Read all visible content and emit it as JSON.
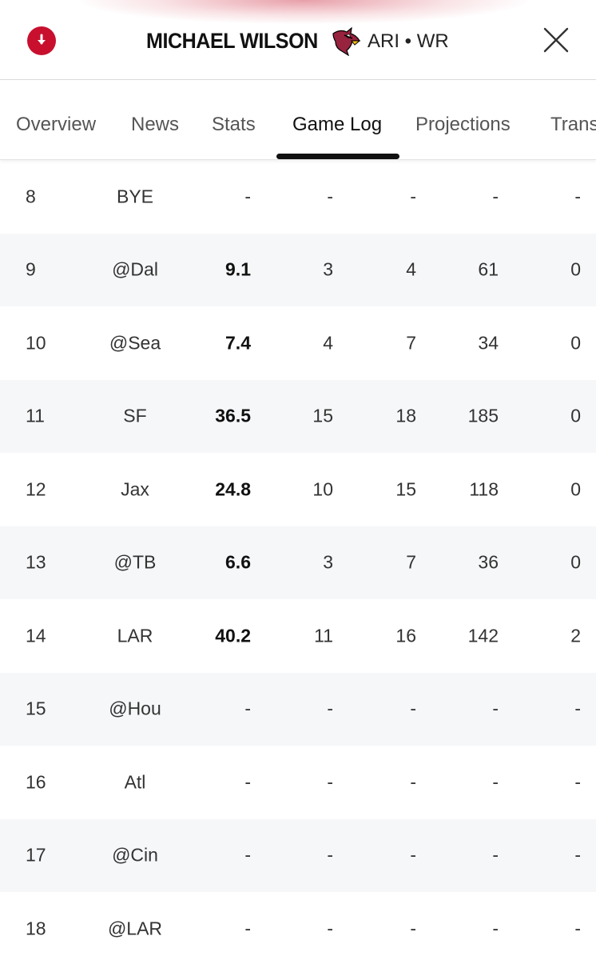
{
  "header": {
    "player_name": "MICHAEL WILSON",
    "team_position": "ARI • WR",
    "accent_color": "#c8102e",
    "icons": [
      "download-icon",
      "cardinals-logo",
      "close-icon"
    ]
  },
  "tabs": [
    {
      "label": "Overview"
    },
    {
      "label": "News"
    },
    {
      "label": "Stats"
    },
    {
      "label": "Game Log",
      "active": true
    },
    {
      "label": "Projections"
    },
    {
      "label": "Trans"
    }
  ],
  "game_log": {
    "rows": [
      {
        "week": "8",
        "opp": "BYE",
        "pts": "-",
        "rec": "-",
        "tgt": "-",
        "yds": "-",
        "td": "-"
      },
      {
        "week": "9",
        "opp": "@Dal",
        "pts": "9.1",
        "rec": "3",
        "tgt": "4",
        "yds": "61",
        "td": "0"
      },
      {
        "week": "10",
        "opp": "@Sea",
        "pts": "7.4",
        "rec": "4",
        "tgt": "7",
        "yds": "34",
        "td": "0"
      },
      {
        "week": "11",
        "opp": "SF",
        "pts": "36.5",
        "rec": "15",
        "tgt": "18",
        "yds": "185",
        "td": "0"
      },
      {
        "week": "12",
        "opp": "Jax",
        "pts": "24.8",
        "rec": "10",
        "tgt": "15",
        "yds": "118",
        "td": "0"
      },
      {
        "week": "13",
        "opp": "@TB",
        "pts": "6.6",
        "rec": "3",
        "tgt": "7",
        "yds": "36",
        "td": "0"
      },
      {
        "week": "14",
        "opp": "LAR",
        "pts": "40.2",
        "rec": "11",
        "tgt": "16",
        "yds": "142",
        "td": "2"
      },
      {
        "week": "15",
        "opp": "@Hou",
        "pts": "-",
        "rec": "-",
        "tgt": "-",
        "yds": "-",
        "td": "-"
      },
      {
        "week": "16",
        "opp": "Atl",
        "pts": "-",
        "rec": "-",
        "tgt": "-",
        "yds": "-",
        "td": "-"
      },
      {
        "week": "17",
        "opp": "@Cin",
        "pts": "-",
        "rec": "-",
        "tgt": "-",
        "yds": "-",
        "td": "-"
      },
      {
        "week": "18",
        "opp": "@LAR",
        "pts": "-",
        "rec": "-",
        "tgt": "-",
        "yds": "-",
        "td": "-"
      }
    ]
  }
}
